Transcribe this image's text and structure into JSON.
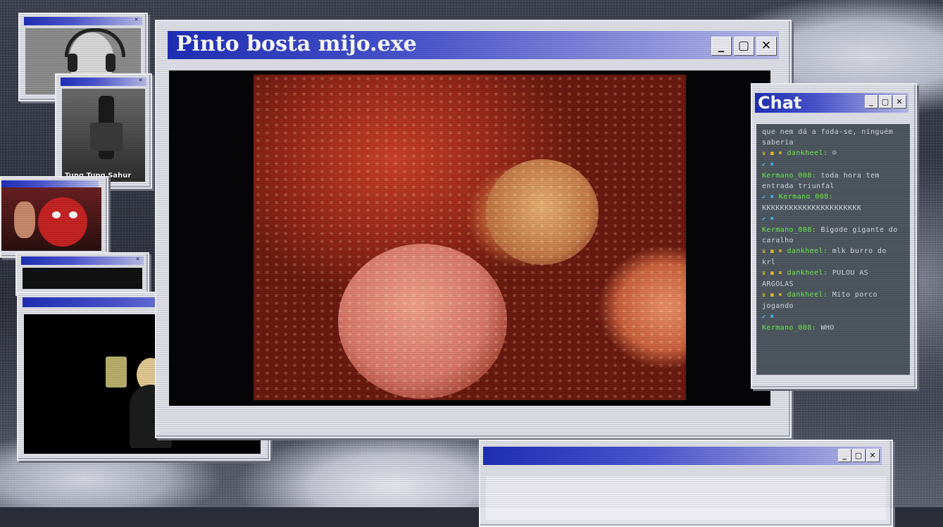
{
  "main_window": {
    "title": "Pinto bosta mijo.exe",
    "controls": [
      "_",
      "▢",
      "✕"
    ]
  },
  "chat_window": {
    "title": "Chat",
    "messages": [
      {
        "user": "",
        "badges": "",
        "text": "que nem dá a foda-se, ninguém saberia"
      },
      {
        "user": "dankheel:",
        "badges": "♛ ◼ ✖",
        "text": "☺"
      },
      {
        "user": "Kermano_008:",
        "badges": "✔ ✖",
        "text": "toda hora tem entrada triunfal"
      },
      {
        "user": "Kermano_008:",
        "badges": "✔ ✖",
        "text": "KKKKKKKKKKKKKKKKKKKKKK"
      },
      {
        "user": "Kermano_008:",
        "badges": "✔ ✖",
        "text": "Bigode gigante do caralho"
      },
      {
        "user": "dankheel:",
        "badges": "♛ ◼ ✖",
        "text": "mlk burro do krl"
      },
      {
        "user": "dankheel:",
        "badges": "♛ ◼ ✖",
        "text": "PULOU AS ARGOLAS"
      },
      {
        "user": "dankheel:",
        "badges": "♛ ◼ ✖",
        "text": "Mito porco jogando"
      },
      {
        "user": "Kermano_008:",
        "badges": "✔ ✖",
        "text": "WHO"
      }
    ]
  },
  "thumbnails": {
    "cam2_caption": "Tung Tung Sahur"
  }
}
